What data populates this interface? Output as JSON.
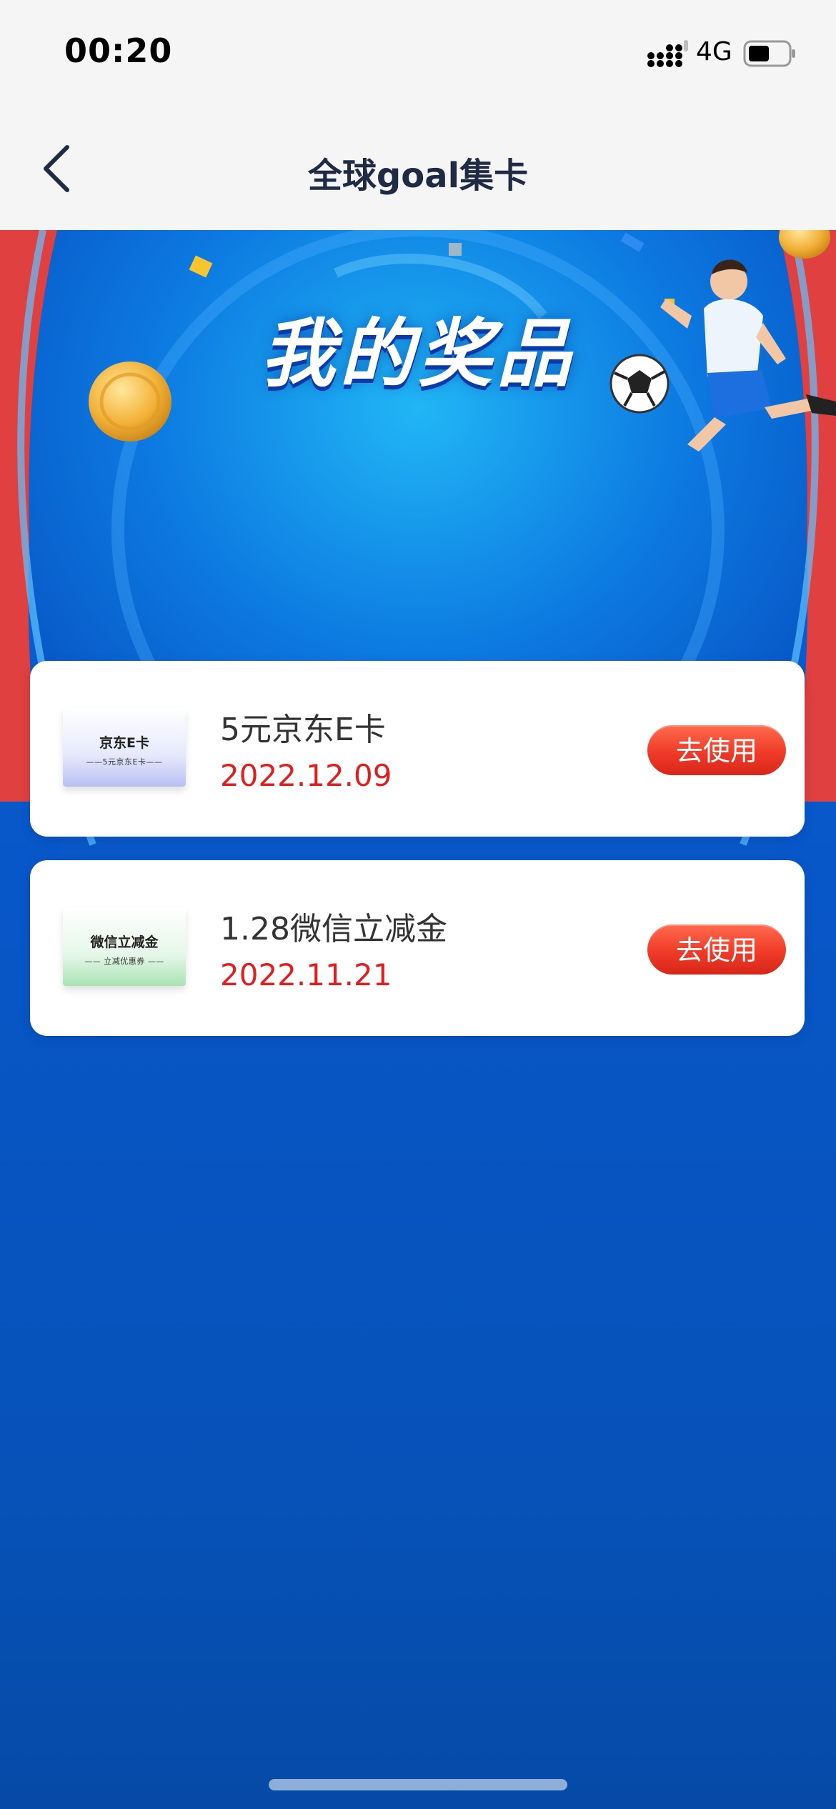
{
  "status_bar": {
    "time": "00:20",
    "network": "4G",
    "signal_icon": "signal-bars-icon",
    "battery_icon": "battery-icon"
  },
  "nav": {
    "title": "全球goal集卡",
    "back_icon": "chevron-left-icon"
  },
  "banner": {
    "title": "我的奖品"
  },
  "prizes": [
    {
      "thumb_title": "京东E卡",
      "thumb_subtitle": "——5元京东E卡——",
      "name": "5元京东E卡",
      "date": "2022.12.09",
      "button_label": "去使用"
    },
    {
      "thumb_title": "微信立减金",
      "thumb_subtitle": "—— 立减优惠券 ——",
      "name": "1.28微信立减金",
      "date": "2022.11.21",
      "button_label": "去使用"
    }
  ],
  "colors": {
    "accent_red": "#e21d1d",
    "button_red": "#ef3b28",
    "background_blue": "#0857c9",
    "title_navy": "#1f2a44"
  }
}
